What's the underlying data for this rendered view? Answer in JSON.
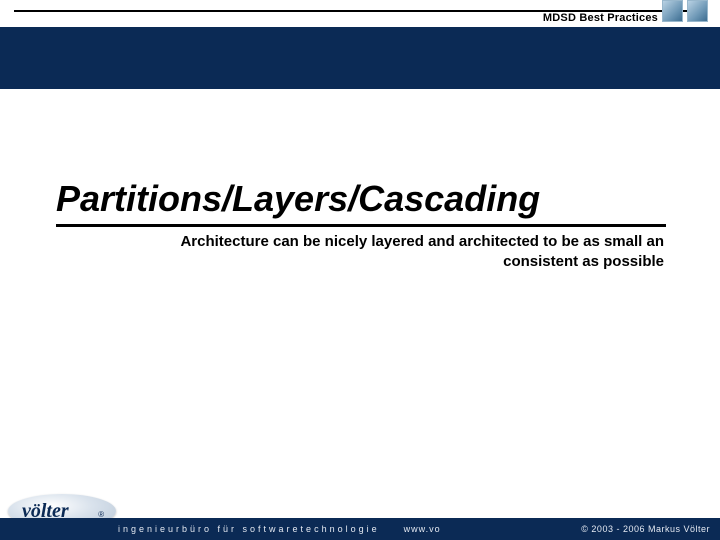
{
  "header": {
    "label": "MDSD Best Practices"
  },
  "title": "Partitions/Layers/Cascading",
  "subtitle": "Architecture can be nicely layered and architected to be as small an consistent as possible",
  "logo": {
    "text": "völter",
    "mark": "®"
  },
  "footer": {
    "left": "ingenieurbüro für softwaretechnologie",
    "mid": "www.vo",
    "right": "© 2003 - 2006 Markus Völter"
  }
}
